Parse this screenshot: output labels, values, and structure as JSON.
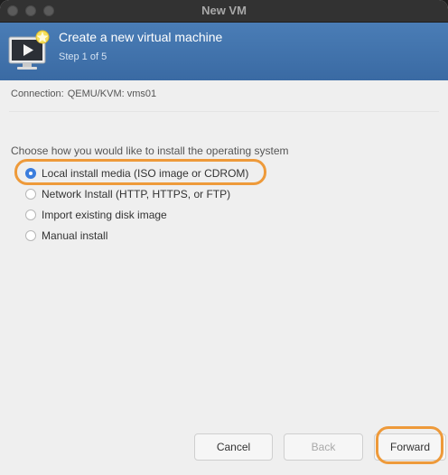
{
  "window": {
    "title": "New VM"
  },
  "header": {
    "title": "Create a new virtual machine",
    "step": "Step 1 of 5",
    "icon": "new-vm-monitor-icon"
  },
  "connection": {
    "label": "Connection:",
    "value": "QEMU/KVM: vms01"
  },
  "install": {
    "prompt": "Choose how you would like to install the operating system",
    "options": [
      {
        "label": "Local install media (ISO image or CDROM)",
        "selected": true
      },
      {
        "label": "Network Install (HTTP, HTTPS, or FTP)",
        "selected": false
      },
      {
        "label": "Import existing disk image",
        "selected": false
      },
      {
        "label": "Manual install",
        "selected": false
      }
    ]
  },
  "buttons": {
    "cancel": "Cancel",
    "back": "Back",
    "forward": "Forward"
  },
  "colors": {
    "header_bg": "#3e71ab",
    "radio_selected": "#3b7ddd",
    "highlight": "#ee9a3a"
  }
}
